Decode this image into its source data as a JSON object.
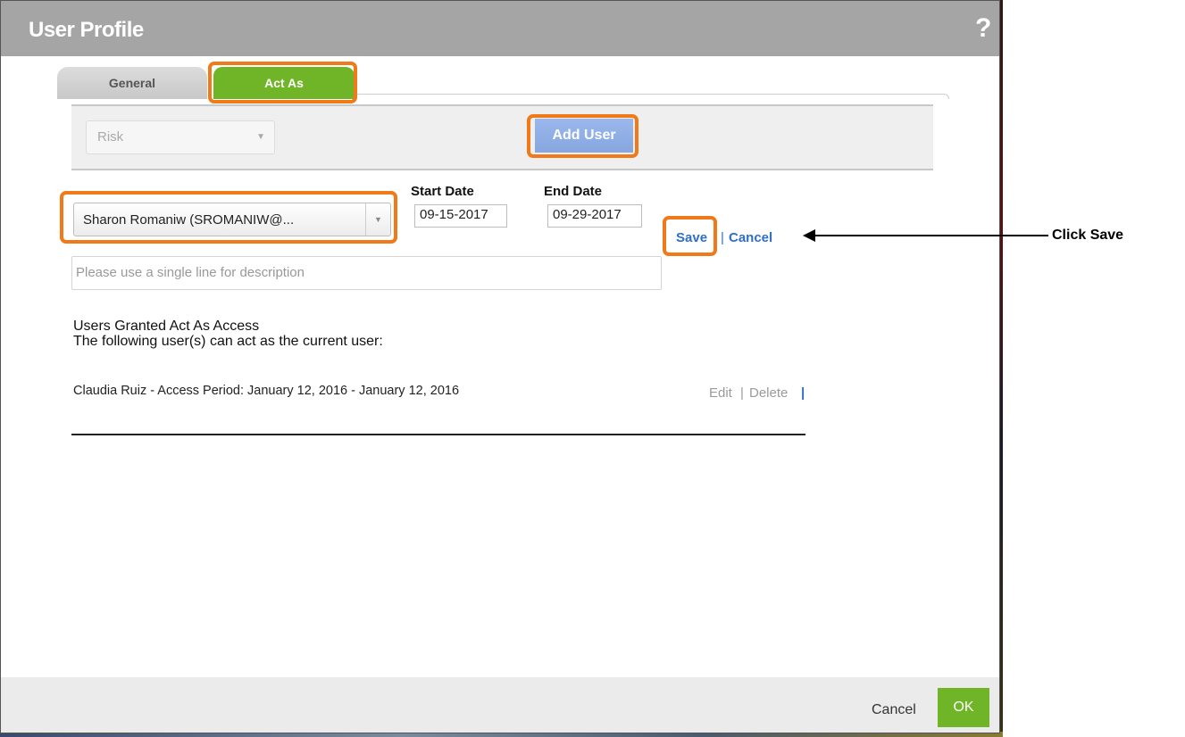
{
  "dialog": {
    "title": "User Profile",
    "help_glyph": "?"
  },
  "tabs": [
    {
      "label": "General"
    },
    {
      "label": "Act As",
      "active": true
    }
  ],
  "toolbar": {
    "role_select_value": "Risk",
    "add_user_label": "Add User"
  },
  "form": {
    "user_select_value": "Sharon Romaniw (SROMANIW@...",
    "start_date_label": "Start Date",
    "start_date_value": "09-15-2017",
    "end_date_label": "End Date",
    "end_date_value": "09-29-2017",
    "save_label": "Save",
    "cancel_label": "Cancel",
    "separator": "|",
    "description_placeholder": "Please use a single line for description"
  },
  "granted": {
    "heading": "Users Granted Act As Access",
    "subheading": "The following user(s) can act as the current user:",
    "rows": [
      {
        "text": "Claudia Ruiz - Access Period: January 12, 2016 - January 12, 2016",
        "edit": "Edit",
        "delete": "Delete"
      }
    ]
  },
  "footer": {
    "cancel_label": "Cancel",
    "ok_label": "OK"
  },
  "annotation": {
    "callout_text": "Click Save"
  },
  "colors": {
    "accent_green": "#6fb527",
    "link_blue": "#2e6fc8",
    "highlight_orange": "#f07a1a",
    "titlebar_gray": "#a5a5a5"
  }
}
